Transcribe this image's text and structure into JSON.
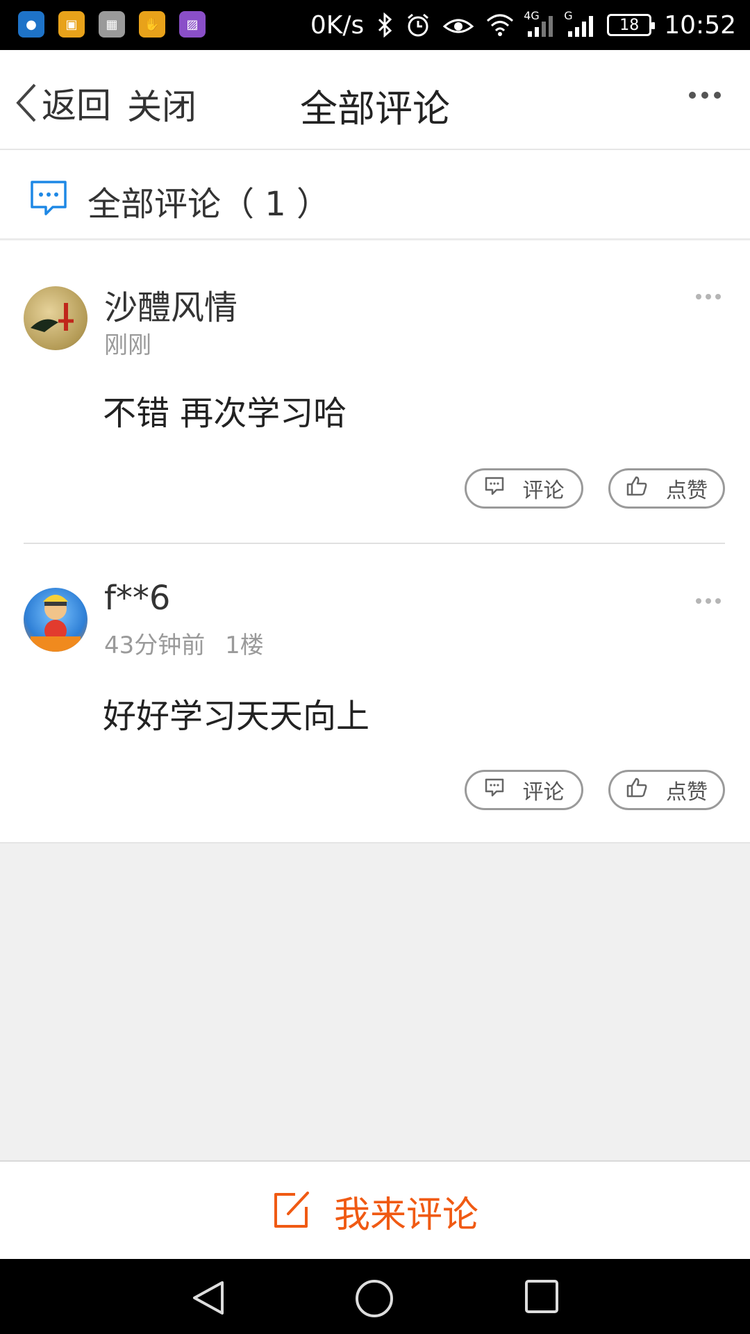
{
  "status_bar": {
    "net_speed": "0K/s",
    "net_4g": "4G",
    "net_g": "G",
    "battery": "18",
    "time": "10:52",
    "app_icon_colors": [
      "#1e73c8",
      "#e8a21a",
      "#9a9a9a",
      "#e8a21a",
      "#8a4fc8"
    ]
  },
  "header": {
    "back_label": "返回",
    "close_label": "关闭",
    "title": "全部评论"
  },
  "section": {
    "title": "全部评论（ 1 ）",
    "accent": "#1e88e5"
  },
  "comments": [
    {
      "username": "沙醴风情",
      "time": "刚刚",
      "floor": "",
      "text": "不错 再次学习哈",
      "comment_label": "评论",
      "like_label": "点赞"
    },
    {
      "username": "f**6",
      "time": "43分钟前",
      "floor": "1楼",
      "text": "好好学习天天向上",
      "comment_label": "评论",
      "like_label": "点赞"
    }
  ],
  "bottom_bar": {
    "write_label": "我来评论",
    "accent": "#f05a13"
  }
}
